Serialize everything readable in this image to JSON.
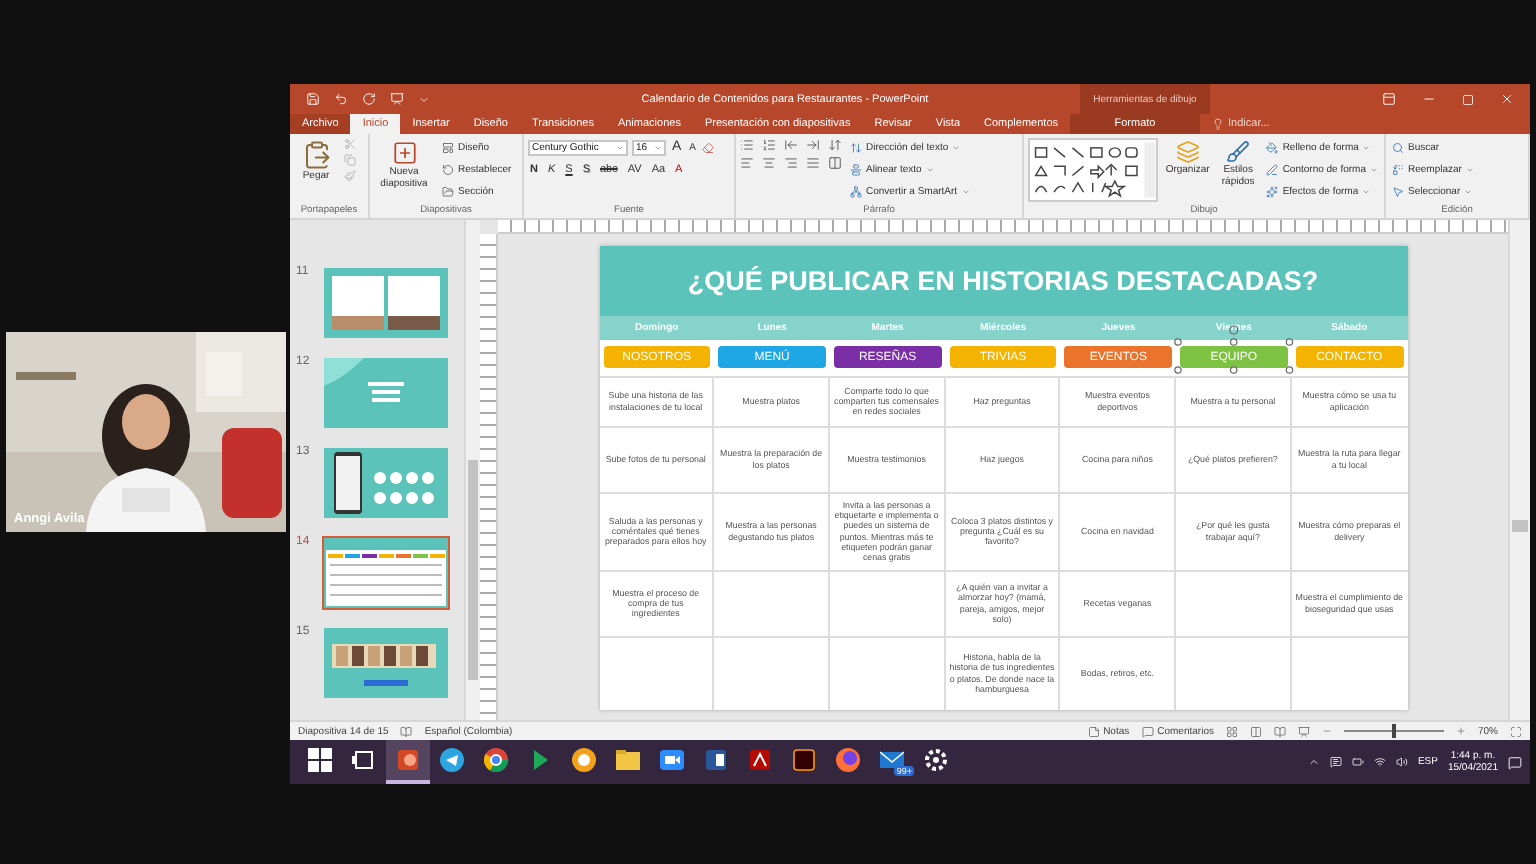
{
  "presenter": {
    "name": "Anngi Avila"
  },
  "window": {
    "title": "Calendario de Contenidos para Restaurantes - PowerPoint",
    "context_group": "Herramientas de dibujo"
  },
  "ribbon_tabs": [
    {
      "label": "Archivo",
      "kind": "file",
      "selected": false
    },
    {
      "label": "Inicio",
      "kind": "tab",
      "selected": true
    },
    {
      "label": "Insertar",
      "kind": "tab",
      "selected": false
    },
    {
      "label": "Diseño",
      "kind": "tab",
      "selected": false
    },
    {
      "label": "Transiciones",
      "kind": "tab",
      "selected": false
    },
    {
      "label": "Animaciones",
      "kind": "tab",
      "selected": false
    },
    {
      "label": "Presentación con diapositivas",
      "kind": "tab",
      "selected": false
    },
    {
      "label": "Revisar",
      "kind": "tab",
      "selected": false
    },
    {
      "label": "Vista",
      "kind": "tab",
      "selected": false
    },
    {
      "label": "Complementos",
      "kind": "tab",
      "selected": false
    },
    {
      "label": "Formato",
      "kind": "context",
      "selected": false
    }
  ],
  "tell_me": {
    "placeholder": "Indicar..."
  },
  "ribbon": {
    "groups": [
      {
        "kind": "clipboard",
        "label": "Portapapeles",
        "main": "Pegar"
      },
      {
        "kind": "slides",
        "label": "Diapositivas",
        "main": "Nueva diapositiva",
        "items": [
          "Diseño",
          "Restablecer",
          "Sección"
        ]
      },
      {
        "kind": "font",
        "label": "Fuente",
        "font_name": "Century Gothic",
        "font_size": "16",
        "grow": "A",
        "shrink": "A",
        "styles": [
          {
            "label": "N",
            "kind": "bold"
          },
          {
            "label": "K",
            "kind": "italic"
          },
          {
            "label": "S",
            "kind": "underline"
          },
          {
            "label": "S",
            "kind": "shadow"
          },
          {
            "label": "abc",
            "kind": "strike"
          },
          {
            "label": "AV",
            "kind": "spacing"
          },
          {
            "label": "Aa",
            "kind": "case"
          },
          {
            "label": "A",
            "kind": "color"
          }
        ]
      },
      {
        "kind": "paragraph",
        "label": "Párrafo",
        "items": [
          "Dirección del texto",
          "Alinear texto",
          "Convertir a SmartArt"
        ]
      },
      {
        "kind": "drawing",
        "label": "Dibujo",
        "large": [
          "Organizar",
          "Estilos rápidos"
        ],
        "items": [
          "Relleno de forma",
          "Contorno de forma",
          "Efectos de forma"
        ]
      },
      {
        "kind": "editing",
        "label": "Edición",
        "items": [
          "Buscar",
          "Reemplazar",
          "Seleccionar"
        ]
      }
    ]
  },
  "thumbnails": [
    {
      "number": "11",
      "kind": "photos",
      "selected": false
    },
    {
      "number": "12",
      "kind": "title",
      "selected": false
    },
    {
      "number": "13",
      "kind": "phone",
      "selected": false
    },
    {
      "number": "14",
      "kind": "table",
      "selected": true
    },
    {
      "number": "15",
      "kind": "gallery",
      "selected": false
    }
  ],
  "slide": {
    "title": "¿QUÉ PUBLICAR EN HISTORIAS DESTACADAS?",
    "days": [
      "Domingo",
      "Lunes",
      "Martes",
      "Miércoles",
      "Jueves",
      "Viernes",
      "Sábado"
    ],
    "categories": [
      {
        "label": "NOSOTROS",
        "color": "#f5b301",
        "selected": false
      },
      {
        "label": "MENÚ",
        "color": "#1ea7e4",
        "selected": false
      },
      {
        "label": "RESEÑAS",
        "color": "#7a2fa6",
        "selected": false
      },
      {
        "label": "TRIVIAS",
        "color": "#f5b301",
        "selected": false
      },
      {
        "label": "EVENTOS",
        "color": "#ea742b",
        "selected": false
      },
      {
        "label": "EQUIPO",
        "color": "#7dc242",
        "selected": true
      },
      {
        "label": "CONTACTO",
        "color": "#f5b301",
        "selected": false
      }
    ],
    "rows": [
      [
        "Sube una historia de las instalaciones de tu local",
        "Muestra platos",
        "Comparte todo lo que comparten tus comensales en redes sociales",
        "Haz preguntas",
        "Muestra eventos deportivos",
        "Muestra a tu personal",
        "Muestra cómo se usa tu aplicación"
      ],
      [
        "Sube fotos de tu personal",
        "Muestra la preparación de los platos",
        "Muestra testimonios",
        "Haz juegos",
        "Cocina para niños",
        "¿Qué platos prefieren?",
        "Muestra la ruta para llegar a tu local"
      ],
      [
        "Saluda a las personas y coméntales qué tienes preparados para ellos hoy",
        "Muestra a las personas degustando tus platos",
        "Invita a las personas a etiquetarte e implementa o puedes un sistema de puntos. Mientras más te etiqueten podrán ganar cenas gratis",
        "Coloca 3 platos distintos y pregunta ¿Cuál es su favorito?",
        "Cocina en navidad",
        "¿Por qué les gusta trabajar aquí?",
        "Muestra cómo preparas el delivery"
      ],
      [
        "Muestra el proceso de compra de tus ingredientes",
        null,
        null,
        "¿A quién van a invitar a almorzar hoy? (mamá, pareja, amigos, mejor solo)",
        "Recetas veganas",
        null,
        "Muestra el cumplimiento de bioseguridad que usas"
      ],
      [
        null,
        null,
        null,
        "Historia, habla de la historia de tus ingredientes o platos. De donde nace la hamburguesa",
        "Bodas, retiros, etc.",
        null,
        null
      ]
    ]
  },
  "status_bar": {
    "slide_position": "Diapositiva 14 de 15",
    "language": "Español (Colombia)",
    "notes": "Notas",
    "comments": "Comentarios",
    "zoom": "70%",
    "level": 0.5
  },
  "taskbar": {
    "apps": [
      {
        "kind": "start",
        "active": false
      },
      {
        "kind": "taskview",
        "active": false
      },
      {
        "kind": "powerpoint",
        "active": true
      },
      {
        "kind": "telegram",
        "active": false
      },
      {
        "kind": "chrome",
        "active": false
      },
      {
        "kind": "arrow",
        "active": false
      },
      {
        "kind": "photos",
        "active": false
      },
      {
        "kind": "folder",
        "active": false
      },
      {
        "kind": "video",
        "active": false
      },
      {
        "kind": "word",
        "active": false
      },
      {
        "kind": "acrobat",
        "active": false
      },
      {
        "kind": "illustrator",
        "active": false
      },
      {
        "kind": "firefox",
        "active": false
      },
      {
        "kind": "mail",
        "active": false,
        "badge": "99+"
      },
      {
        "kind": "settings",
        "active": false
      }
    ],
    "language": "ESP",
    "time": "1:44 p. m.",
    "date": "15/04/2021"
  }
}
